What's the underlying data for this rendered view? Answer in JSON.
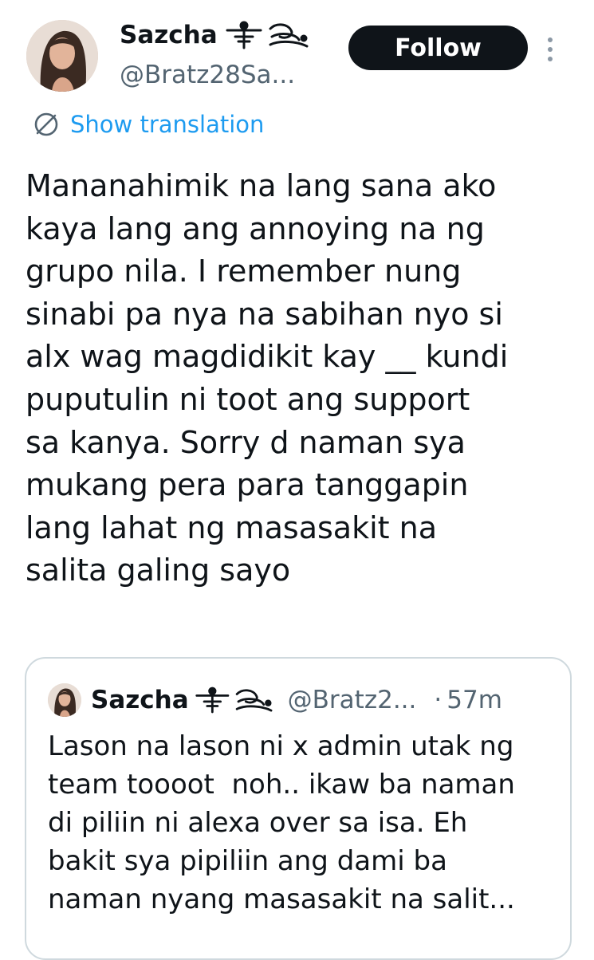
{
  "author": {
    "display_name": "Sazcha",
    "handle": "@Bratz28Sa...",
    "avatar_icon": "profile-photo"
  },
  "follow_button": {
    "label": "Follow"
  },
  "more_menu": {
    "icon": "more-vertical-icon"
  },
  "translation": {
    "label": "Show translation",
    "icon": "globe-translate-icon"
  },
  "tweet": {
    "text": "Mananahimik na lang sana ako\nkaya lang ang annoying na ng\ngrupo nila. I remember nung\nsinabi pa nya na sabihan nyo si\nalx wag magdidikit kay __ kundi\npuputulin ni toot ang support\nsa kanya. Sorry d naman sya\nmukang pera para tanggapin\nlang lahat ng masasakit na\nsalita galing sayo"
  },
  "quoted_tweet": {
    "display_name": "Sazcha",
    "handle": "@Bratz2...",
    "separator": "·",
    "time": "57m",
    "text": "Lason na lason ni x admin utak ng\nteam toooot  noh.. ikaw ba naman\ndi piliin ni alexa over sa isa. Eh\nbakit sya pipiliin ang dami ba\nnaman nyang masasakit na salit..."
  },
  "colors": {
    "text_primary": "#0f1419",
    "text_secondary": "#536471",
    "link": "#1d9bf0",
    "follow_bg": "#0f1419",
    "border": "#cfd9de"
  }
}
